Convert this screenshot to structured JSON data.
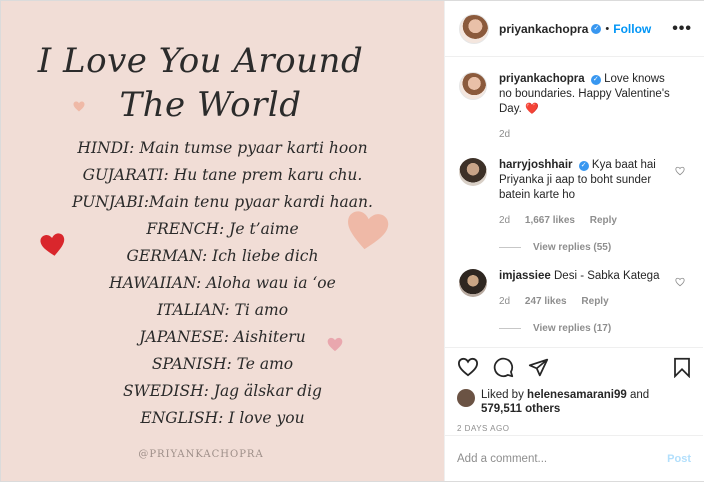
{
  "image": {
    "title_line1": "I Love You Around",
    "title_line2": "The World",
    "phrases": [
      "HINDI: Main tumse pyaar karti hoon",
      "GUJARATI: Hu tane prem karu chu.",
      "PUNJABI:Main tenu pyaar kardi haan.",
      "FRENCH: Je t’aime",
      "GERMAN: Ich liebe dich",
      "HAWAIIAN: Aloha wau ia ‘oe",
      "ITALIAN: Ti amo",
      "JAPANESE: Aishiteru",
      "SPANISH: Te amo",
      "SWEDISH: Jag älskar dig",
      "ENGLISH: I love you"
    ],
    "credit": "@PRIYANKACHOPRA",
    "colors": {
      "background": "#f1ddd6",
      "heart_red": "#d9262c",
      "heart_peach": "#efb9a7",
      "heart_pink": "#e9a7ae"
    }
  },
  "header": {
    "username": "priyankachopra",
    "verified_icon": "verified-badge",
    "separator": "•",
    "follow_label": "Follow",
    "more_icon": "•••"
  },
  "caption": {
    "username": "priyankachopra",
    "text": "Love knows no boundaries. Happy Valentine's Day.",
    "emoji": "❤️",
    "age": "2d"
  },
  "comments": [
    {
      "username": "harryjoshhair",
      "verified": true,
      "text": "Kya baat hai Priyanka ji aap to boht sunder batein karte ho",
      "age": "2d",
      "likes": "1,667 likes",
      "reply_label": "Reply",
      "view_replies": "View replies (55)"
    },
    {
      "username": "imjassiee",
      "verified": false,
      "text": "Desi - Sabka Katega",
      "age": "2d",
      "likes": "247 likes",
      "reply_label": "Reply",
      "view_replies": "View replies (17)"
    }
  ],
  "likes": {
    "prefix": "Liked by",
    "user": "helenesamarani99",
    "joiner": "and",
    "count": "579,511 others"
  },
  "timestamp": "2 DAYS AGO",
  "add_comment": {
    "placeholder": "Add a comment...",
    "post_label": "Post"
  },
  "colors": {
    "accent": "#0095f6",
    "post_disabled": "#b2dffc",
    "muted": "#8e8e8e",
    "heart_red": "#ed4956"
  }
}
